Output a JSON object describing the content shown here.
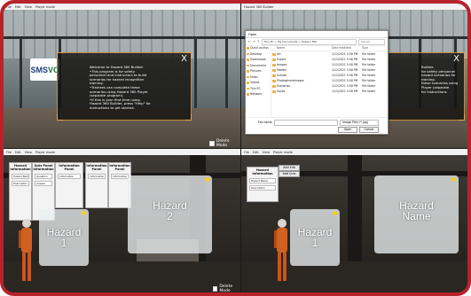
{
  "menu": [
    "File",
    "Edit",
    "View",
    "Player mode"
  ],
  "q1": {
    "logo": {
      "s1": "SMS",
      "s2": "VC"
    },
    "welcome_text": "Welcome to Hazard 360 Builder.\n•This program is for safety personnel and instructors to build scenarios for hazard recognition training.\n•Trainees can complete these scenarios using Hazard 360 Player (separate program).\n•If this is your first time using Hazard 360 Builder, press \"Help\" for instructions to get started.",
    "close": "X",
    "delete_mode": "Delete Mode"
  },
  "q2": {
    "window_title": "Hazard 360 Builder",
    "explorer_title": "Open",
    "address": "This PC > My Documents > Hazard 360",
    "search_placeholder": "Search",
    "sidebar": [
      "Quick access",
      "Desktop",
      "Downloads",
      "Documents",
      "Pictures",
      "Music",
      "Videos",
      "This PC",
      "Network"
    ],
    "columns": [
      "Name",
      "Date modified",
      "Type"
    ],
    "rows": [
      {
        "name": "Art",
        "date": "1/12/2021 5:58 PM",
        "type": "File folder"
      },
      {
        "name": "Export",
        "date": "1/12/2021 5:58 PM",
        "type": "File folder"
      },
      {
        "name": "Images",
        "date": "1/12/2021 5:58 PM",
        "type": "File folder"
      },
      {
        "name": "Models",
        "date": "1/12/2021 5:58 PM",
        "type": "File folder"
      },
      {
        "name": "Scenes",
        "date": "1/12/2021 5:58 PM",
        "type": "File folder"
      },
      {
        "name": "PhotosphereImages",
        "date": "1/12/2021 5:58 PM",
        "type": "File folder"
      },
      {
        "name": "Scenarios",
        "date": "1/12/2021 5:58 PM",
        "type": "File folder"
      },
      {
        "name": "Saves",
        "date": "1/12/2021 5:58 PM",
        "type": "File folder"
      }
    ],
    "filename_label": "File name:",
    "filetype": "Image Files (*.jpg)",
    "open_btn": "Open",
    "cancel_btn": "Cancel",
    "close": "X",
    "partial_text": "Builder.\nfor safety personnel\nhazard scenarios for\ntraining.\nthese scenarios using\nPlayer (separate\nfor instructions"
  },
  "q3": {
    "panels": [
      {
        "title": "Hazard Information",
        "fields": [
          "Hazard Name",
          "Description"
        ]
      },
      {
        "title": "Quiz Panel Information",
        "fields": [
          "Question",
          "Answer"
        ]
      },
      {
        "title": "Information Panel",
        "fields": [
          "Information"
        ]
      },
      {
        "title": "Information Panel",
        "fields": [
          "Information"
        ]
      },
      {
        "title": "Information Panel",
        "fields": [
          "Information"
        ]
      }
    ],
    "cards": [
      "Hazard\n1",
      "Hazard\n2"
    ],
    "delete_mode": "Delete Mode"
  },
  "q4": {
    "panel_title": "Hazard Information",
    "fields": [
      "Hazard Name",
      "Description"
    ],
    "tab1": "Add Info",
    "tab2": "Add Quiz",
    "cards": [
      "Hazard\n1",
      "Hazard\nName"
    ]
  },
  "colors": {
    "frame": "#b8232b",
    "modal_border": "#c48a3a",
    "hazard_dot": "#f0d020"
  }
}
